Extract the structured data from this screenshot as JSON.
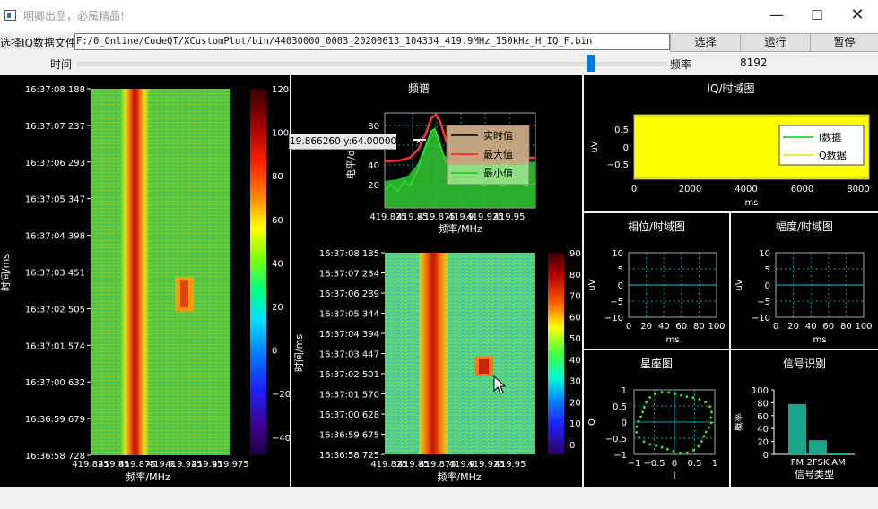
{
  "window": {
    "title": "明卿出品，必属精品!"
  },
  "toolbar": {
    "file_label": "选择IQ数据文件",
    "file_path": "F:/0_Online/CodeQT/XCustomPlot/bin/44030000_0003_20200613_104334_419.9MHz_150kHz_H_IQ_F.bin",
    "select_button": "选择",
    "run_button": "运行",
    "pause_button": "暂停",
    "time_label": "时间",
    "freq_label": "频率",
    "freq_value": "8192",
    "slider_position": 0.88
  },
  "waterfall_large": {
    "ylabel": "时间/ms",
    "xlabel": "频率/MHz",
    "y_ticks": [
      "16:37:08 188",
      "16:37:07 237",
      "16:37:06 293",
      "16:37:05 347",
      "16:37:04 398",
      "16:37:03 451",
      "16:37:02 505",
      "16:37:01 574",
      "16:37:00 632",
      "16:36:59 679",
      "16:36:58 728"
    ],
    "x_ticks": [
      "419.825",
      "419.85",
      "419.875",
      "419.9",
      "419.925",
      "419.95",
      "419.975"
    ],
    "colorbar_ticks": [
      "120",
      "100",
      "80",
      "60",
      "40",
      "20",
      "0",
      "−20",
      "−40"
    ]
  },
  "spectrum": {
    "title": "频谱",
    "ylabel": "电平/dB",
    "xlabel": "频率/MHz",
    "y_ticks": [
      "80",
      "60",
      "40",
      "20"
    ],
    "x_ticks": [
      "419.825",
      "419.85",
      "419.875",
      "419.9",
      "419.925",
      "419.95"
    ],
    "legend": [
      "实时值",
      "最大值",
      "最小值"
    ],
    "tooltip": "19.866260 y:64.000000",
    "colors": {
      "realtime": "#000000",
      "max": "#ff3030",
      "min": "#33dd33"
    }
  },
  "waterfall_small": {
    "ylabel": "时间/ms",
    "xlabel": "频率/MHz",
    "y_ticks": [
      "16:37:08 185",
      "16:37:07 234",
      "16:37:06 289",
      "16:37:05 344",
      "16:37:04 394",
      "16:37:03 447",
      "16:37:02 501",
      "16:37:01 570",
      "16:37:00 628",
      "16:36:59 675",
      "16:36:58 725"
    ],
    "x_ticks": [
      "419.825",
      "419.85",
      "419.875",
      "419.9",
      "419.925",
      "419.95"
    ],
    "colorbar_ticks": [
      "90",
      "80",
      "70",
      "60",
      "50",
      "40",
      "30",
      "20",
      "10",
      "0"
    ]
  },
  "iq_time": {
    "title": "IQ/时域图",
    "ylabel": "uV",
    "xlabel": "ms",
    "y_ticks": [
      "0.5",
      "0",
      "−0.5"
    ],
    "x_ticks": [
      "0",
      "2000",
      "4000",
      "6000",
      "8000"
    ],
    "legend": [
      "I数据",
      "Q数据"
    ],
    "colors": {
      "i": "#00cc00",
      "q": "#ffff00"
    }
  },
  "phase_time": {
    "title": "相位/时域图",
    "ylabel": "uV",
    "xlabel": "ms",
    "y_ticks": [
      "10",
      "5",
      "0",
      "−5",
      "−10"
    ],
    "x_ticks": [
      "0",
      "20",
      "40",
      "60",
      "80",
      "100"
    ]
  },
  "amp_time": {
    "title": "幅度/时域图",
    "ylabel": "uV",
    "xlabel": "ms",
    "y_ticks": [
      "10",
      "5",
      "0",
      "−5",
      "−10"
    ],
    "x_ticks": [
      "0",
      "20",
      "40",
      "60",
      "80",
      "100"
    ]
  },
  "constellation": {
    "title": "星座图",
    "ylabel": "Q",
    "xlabel": "I",
    "y_ticks": [
      "1",
      "0.5",
      "0",
      "−0.5",
      "−1"
    ],
    "x_ticks": [
      "−1",
      "−0.5",
      "0",
      "0.5",
      "1"
    ]
  },
  "signal_id": {
    "title": "信号识别",
    "ylabel": "概率",
    "xlabel": "信号类型",
    "y_ticks": [
      "100",
      "80",
      "60",
      "40",
      "20",
      "0"
    ],
    "chart_data": {
      "type": "bar",
      "categories": [
        "FM",
        "2FSK",
        "AM"
      ],
      "values": [
        78,
        22,
        2
      ],
      "ylim": [
        0,
        100
      ],
      "color": "#1aa58a"
    }
  }
}
